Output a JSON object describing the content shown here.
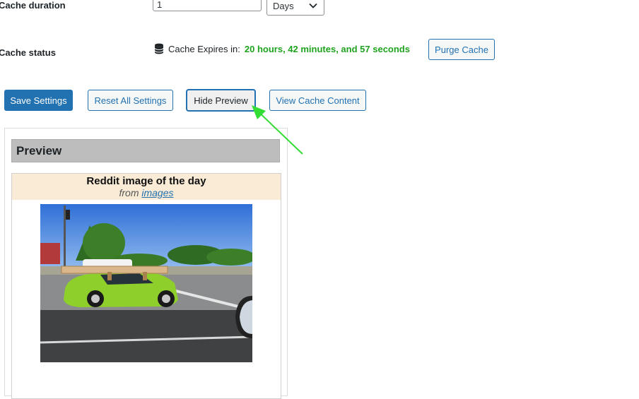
{
  "settings": {
    "cache_duration_label": "Cache duration",
    "cache_duration_value": "1",
    "cache_duration_unit": "Days",
    "cache_status_label": "Cache status",
    "cache_expires_prefix": "Cache Expires in:",
    "cache_expires_value": "20 hours, 42 minutes, and 57 seconds",
    "purge_cache_label": "Purge Cache"
  },
  "actions": {
    "save_label": "Save Settings",
    "reset_label": "Reset All Settings",
    "hide_preview_label": "Hide Preview",
    "view_cache_label": "View Cache Content"
  },
  "preview": {
    "heading": "Preview",
    "card_title": "Reddit image of the day",
    "from_text": "from",
    "subreddit_link": "images"
  },
  "colors": {
    "accent": "#2271b1",
    "status_green": "#1fa31f",
    "annotation_arrow": "#33dd33"
  },
  "icons": {
    "status_icon": "database-icon",
    "select_icon": "chevron-down-icon"
  }
}
